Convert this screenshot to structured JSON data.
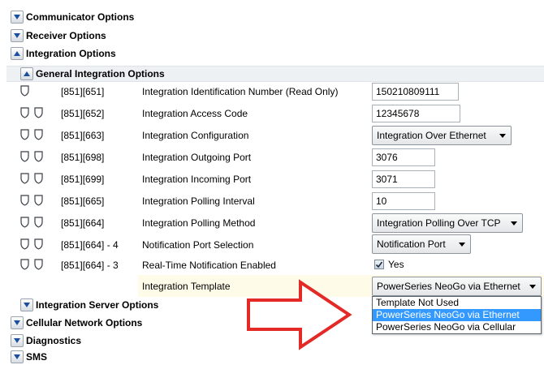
{
  "sections": {
    "communicator": "Communicator Options",
    "receiver": "Receiver Options",
    "integration": "Integration Options",
    "general": "General Integration Options",
    "integration_server": "Integration Server Options",
    "cellular": "Cellular Network Options",
    "diagnostics": "Diagnostics",
    "sms": "SMS"
  },
  "rows": [
    {
      "section": "[851][651]",
      "name": "Integration Identification Number (Read Only)",
      "value": "150210809111"
    },
    {
      "section": "[851][652]",
      "name": "Integration Access Code",
      "value": "12345678"
    },
    {
      "section": "[851][663]",
      "name": "Integration Configuration",
      "value": "Integration Over Ethernet"
    },
    {
      "section": "[851][698]",
      "name": "Integration Outgoing Port",
      "value": "3076"
    },
    {
      "section": "[851][699]",
      "name": "Integration Incoming Port",
      "value": "3071"
    },
    {
      "section": "[851][665]",
      "name": "Integration Polling Interval",
      "value": "10"
    },
    {
      "section": "[851][664]",
      "name": "Integration Polling Method",
      "value": "Integration Polling Over TCP"
    },
    {
      "section": "[851][664] - 4",
      "name": "Notification Port Selection",
      "value": "Notification Port"
    },
    {
      "section": "[851][664] - 3",
      "name": "Real-Time Notification Enabled",
      "value": "Yes"
    },
    {
      "section": "",
      "name": "Integration Template",
      "value": "PowerSeries NeoGo via Ethernet"
    }
  ],
  "template_options": [
    "Template Not Used",
    "PowerSeries NeoGo via Ethernet",
    "PowerSeries NeoGo via Cellular"
  ],
  "template_selected": "PowerSeries NeoGo via Ethernet",
  "colors": {
    "arrow": "#e32a26",
    "selection": "#3399ff",
    "expander_arrow": "#1a4f9e"
  }
}
